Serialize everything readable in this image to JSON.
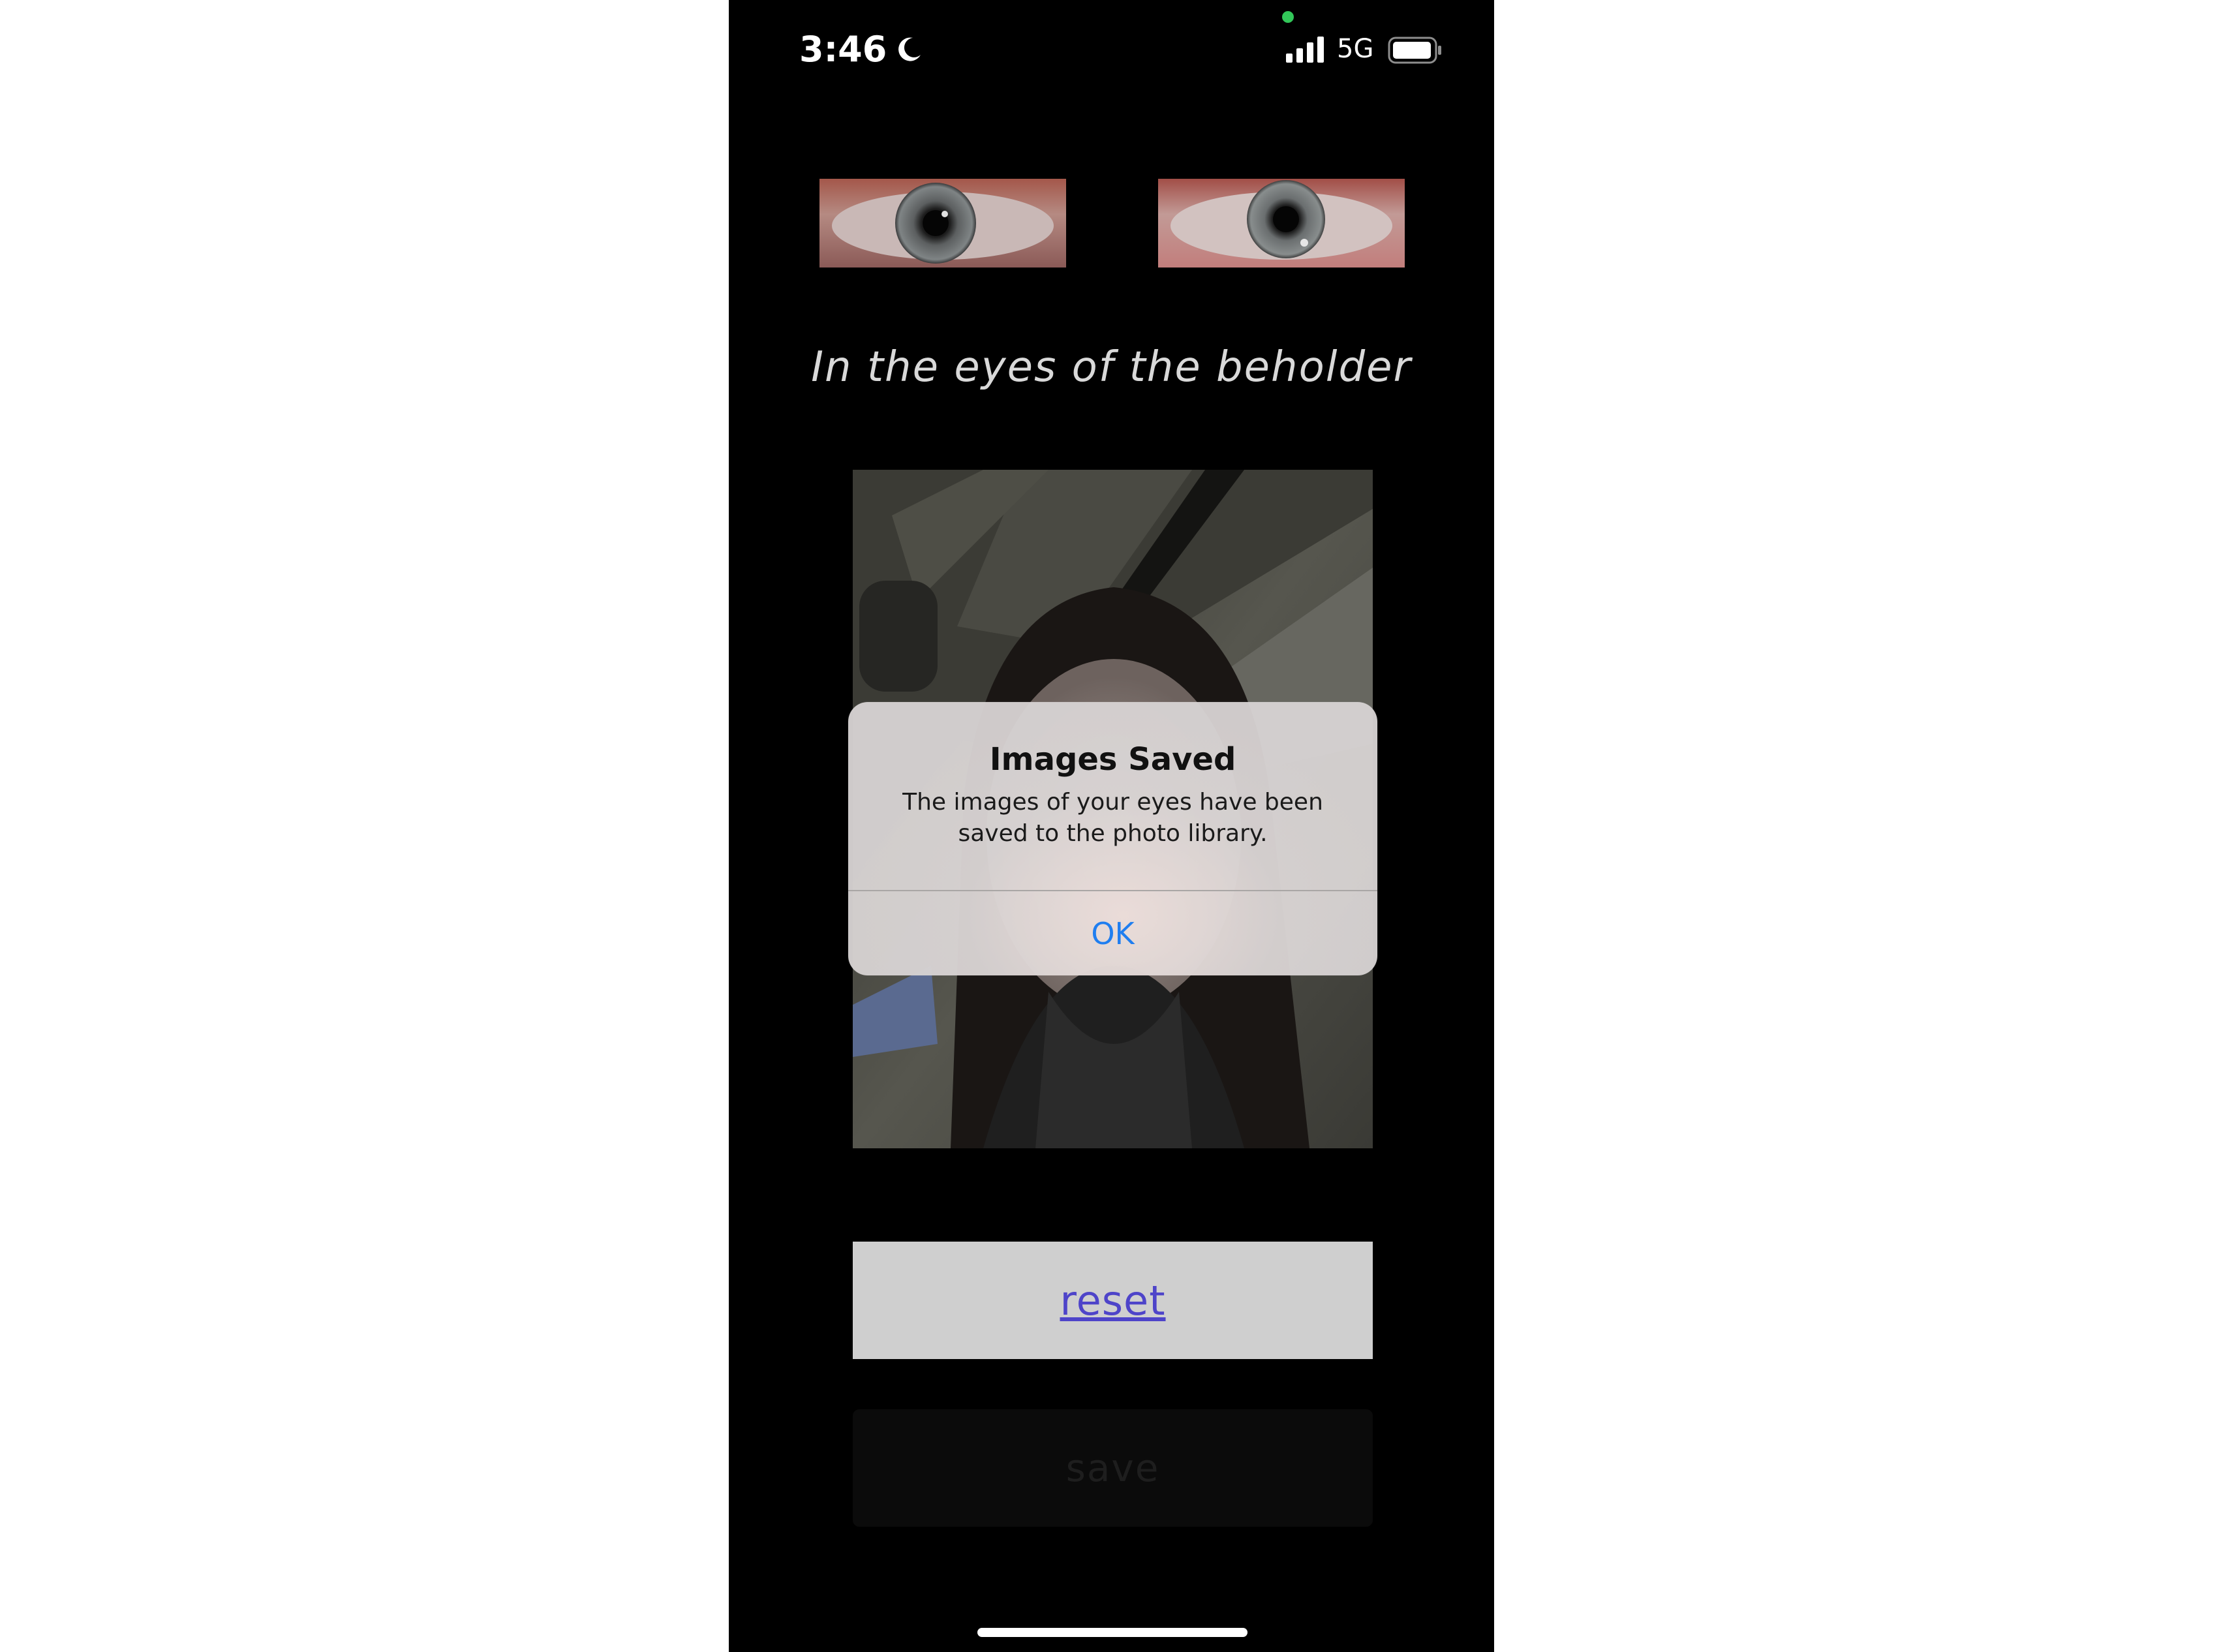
{
  "status_bar": {
    "time": "3:46",
    "network": "5G",
    "icons": [
      "moon-icon",
      "signal-icon",
      "battery-icon"
    ]
  },
  "app": {
    "tagline": "In the eyes of the beholder",
    "images": [
      "left-eye-thumbnail",
      "right-eye-thumbnail",
      "camera-preview"
    ],
    "reset_label": "reset",
    "save_label": "save",
    "accent_color": "#4e44c9"
  },
  "alert": {
    "title": "Images Saved",
    "message": "The images of your eyes have been saved to the photo library.",
    "ok_label": "OK",
    "ok_color": "#1f7ef0"
  }
}
